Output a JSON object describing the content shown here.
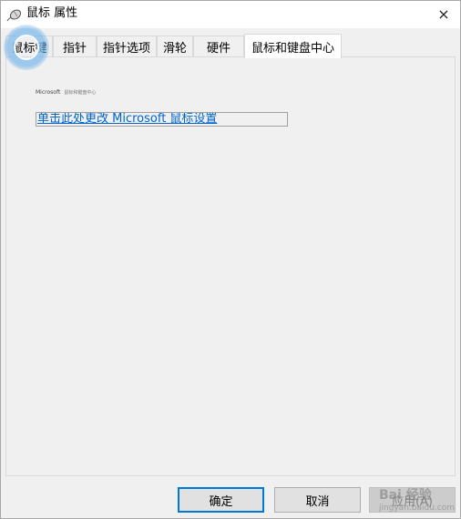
{
  "window": {
    "title": "鼠标 属性",
    "close_label": "×"
  },
  "tabs": [
    {
      "label": "鼠标键",
      "active": false
    },
    {
      "label": "指针",
      "active": false
    },
    {
      "label": "指针选项",
      "active": false
    },
    {
      "label": "滑轮",
      "active": false
    },
    {
      "label": "硬件",
      "active": false
    },
    {
      "label": "鼠标和键盘中心",
      "active": true
    }
  ],
  "panel": {
    "logo_text": "Microsoft",
    "logo_subtext": "鼠标和键盘中心",
    "link_text": "单击此处更改 Microsoft 鼠标设置"
  },
  "buttons": {
    "ok_label": "确定",
    "cancel_label": "取消",
    "apply_label": "应用(A)"
  },
  "watermark": {
    "text": "Bai 经验",
    "subtext": "jingyan.baidu.com"
  },
  "colors": {
    "accent": "#0078d7",
    "link": "#0066cc",
    "click_ring": "#5aa5e6"
  }
}
